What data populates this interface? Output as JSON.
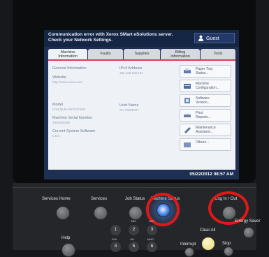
{
  "alert": {
    "line1": "Communication error with Xerox SMart eSolutions server.",
    "line2": "Check your Network Settings."
  },
  "user_button": {
    "label": "Guest",
    "icon": "person-icon"
  },
  "tabs": [
    {
      "label": "Machine\nInformation",
      "active": true
    },
    {
      "label": "Faults"
    },
    {
      "label": "Supplies"
    },
    {
      "label": "Billing\nInformation"
    },
    {
      "label": "Tools"
    }
  ],
  "info": {
    "general_information": "General Information",
    "website_label": "Website",
    "website_value": "http://www.xerox.com",
    "model_label": "Model",
    "model_value": "ColorQube 8570 Printer",
    "serial_label": "Machine Serial Number",
    "serial_value": "3326050256",
    "software_label": "Current System Software",
    "software_value": "0.0.0",
    "ipv4_label": "IPv4 Address",
    "ipv4_value": "192.168.100.101",
    "host_label": "Host Name",
    "host_value": "XC-HW98627"
  },
  "side_buttons": [
    {
      "label": "Paper Tray\nStatus...",
      "icon": "paper-tray-icon"
    },
    {
      "label": "Machine\nConfiguration...",
      "icon": "machine-config-icon"
    },
    {
      "label": "Software\nVersion...",
      "icon": "software-icon"
    },
    {
      "label": "Print\nReports...",
      "icon": "printer-icon"
    },
    {
      "label": "Maintenance\nAssistant...",
      "icon": "wrench-icon"
    },
    {
      "label": "Others...",
      "icon": "others-icon"
    }
  ],
  "datetime": "05/22/2012  08:57 AM",
  "panel": {
    "services_home": "Services Home",
    "services": "Services",
    "job_status": "Job Status",
    "machine_status": "Machine Status",
    "log_in_out": "Log In / Out",
    "energy_saver": "Energy Saver",
    "help": "Help",
    "clear_all": "Clear All",
    "interrupt": "Interrupt",
    "stop": "Stop",
    "keys": [
      {
        "num": "1",
        "letters": ""
      },
      {
        "num": "2",
        "letters": "ABC"
      },
      {
        "num": "3",
        "letters": "DEF"
      },
      {
        "num": "4",
        "letters": "GHI"
      },
      {
        "num": "5",
        "letters": "JKL"
      },
      {
        "num": "6",
        "letters": "MNO"
      }
    ]
  },
  "colors": {
    "tab_accent": "#e33355",
    "highlight_ring": "#e01818",
    "status_led": "#3d7ee8"
  }
}
